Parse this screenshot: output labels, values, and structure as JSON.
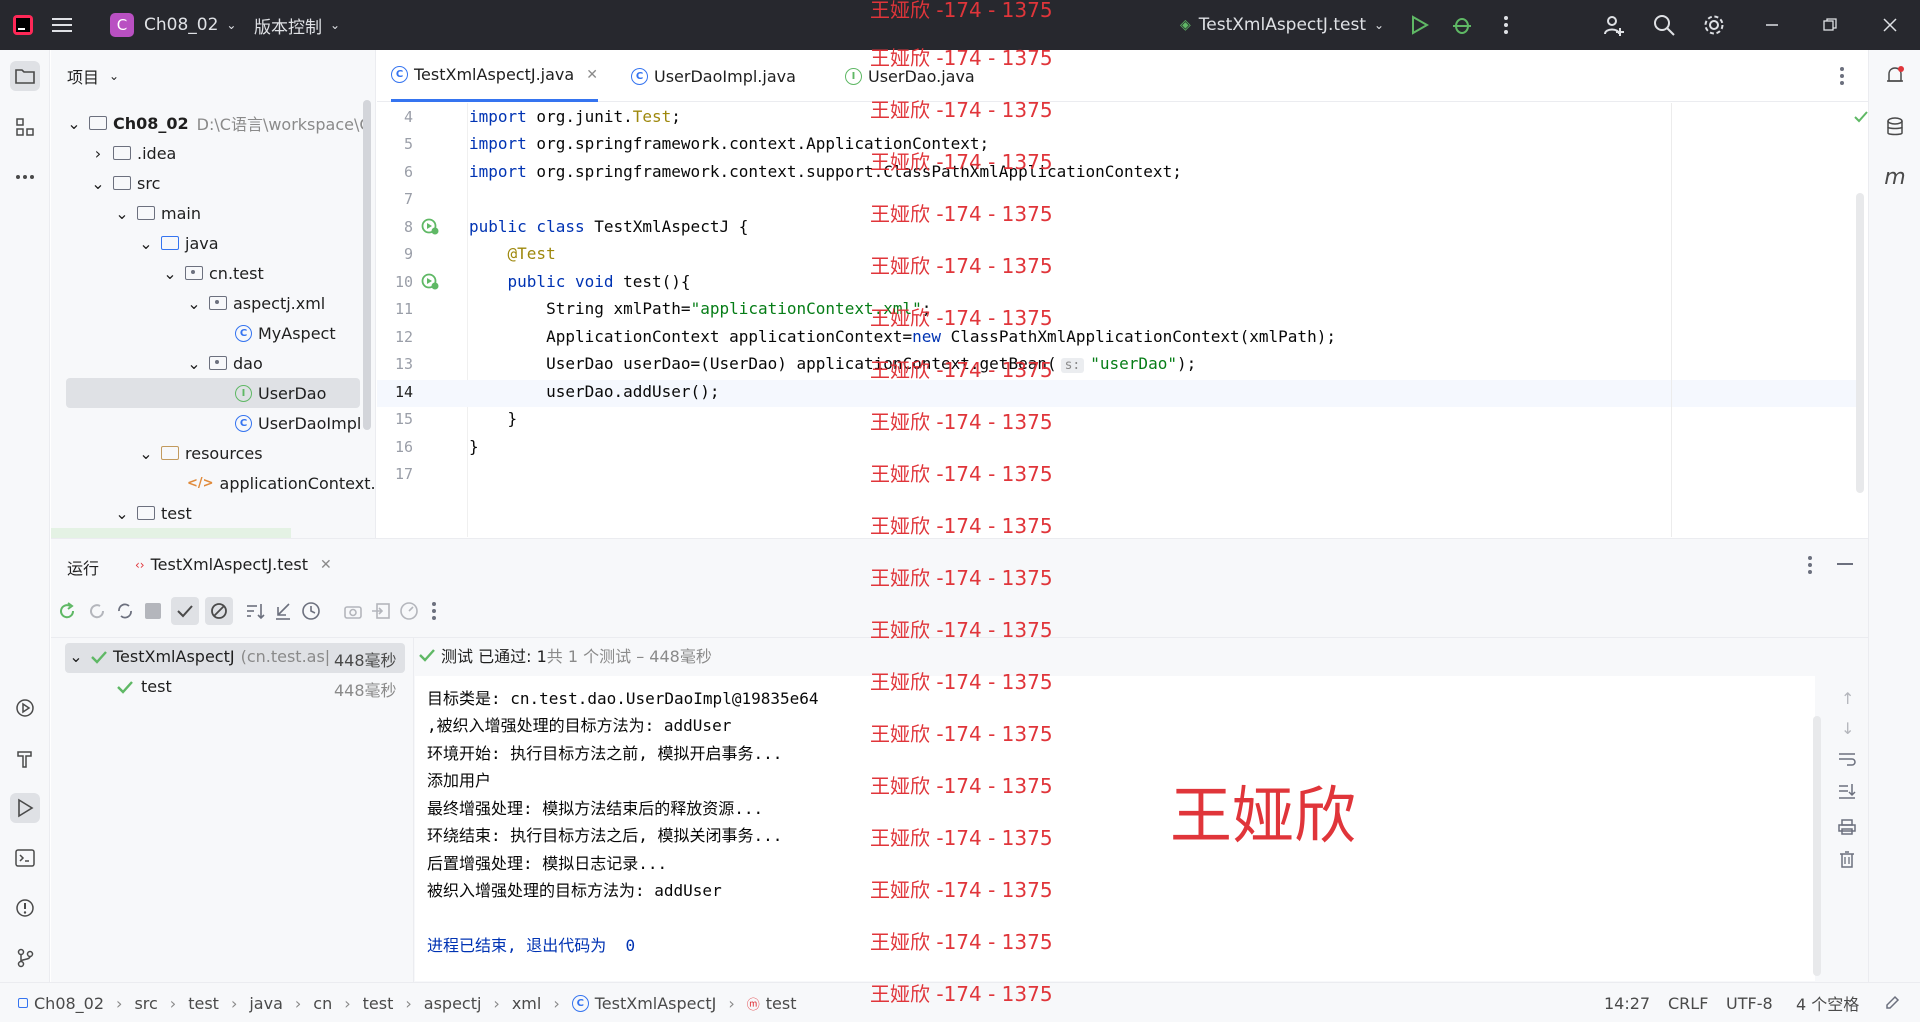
{
  "titlebar": {
    "project_initial": "C",
    "project_name": "Ch08_02",
    "vcs_menu": "版本控制",
    "run_config": "TestXmlAspectJ.test"
  },
  "project_panel": {
    "title": "项目",
    "tree": [
      {
        "label": "Ch08_02",
        "path": "D:\\C语言\\workspace\\C",
        "icon": "folder-icon"
      },
      {
        "label": ".idea",
        "icon": "folder-icon"
      },
      {
        "label": "src",
        "icon": "folder-icon"
      },
      {
        "label": "main",
        "icon": "folder-icon"
      },
      {
        "label": "java",
        "icon": "source-folder-icon"
      },
      {
        "label": "cn.test",
        "icon": "package-icon"
      },
      {
        "label": "aspectj.xml",
        "icon": "package-icon"
      },
      {
        "label": "MyAspect",
        "icon": "class-icon"
      },
      {
        "label": "dao",
        "icon": "package-icon"
      },
      {
        "label": "UserDao",
        "icon": "interface-icon"
      },
      {
        "label": "UserDaoImpl",
        "icon": "class-icon"
      },
      {
        "label": "resources",
        "icon": "resources-folder-icon"
      },
      {
        "label": "applicationContext.xn",
        "icon": "xml-file-icon"
      },
      {
        "label": "test",
        "icon": "folder-icon"
      }
    ]
  },
  "editor_tabs": [
    {
      "label": "TestXmlAspectJ.java",
      "active": true
    },
    {
      "label": "UserDaoImpl.java",
      "active": false
    },
    {
      "label": "UserDao.java",
      "active": false
    }
  ],
  "code": {
    "line_numbers": [
      "4",
      "5",
      "6",
      "7",
      "8",
      "9",
      "10",
      "11",
      "12",
      "13",
      "14",
      "15",
      "16",
      "17"
    ],
    "l4_kw": "import",
    "l4_rest": " org.junit.",
    "l4_cls": "Test",
    "l4_end": ";",
    "l5_kw": "import",
    "l5_rest": " org.springframework.context.ApplicationContext;",
    "l6_kw": "import",
    "l6_rest": " org.springframework.context.support.ClassPathXmlApplicationContext;",
    "l8_kw": "public class",
    "l8_rest": " TestXmlAspectJ {",
    "l9_ann": "@Test",
    "l10_kw": "public void",
    "l10_rest": " test(){",
    "l11_a": "String xmlPath=",
    "l11_str": "\"applicationContext.xml\"",
    "l11_end": ";",
    "l12_a": "ApplicationContext applicationContext=",
    "l12_kw": "new",
    "l12_rest": " ClassPathXmlApplicationContext(xmlPath);",
    "l13_a": "UserDao userDao=(UserDao) applicationContext.getBean(",
    "l13_hint": "s:",
    "l13_str": "\"userDao\"",
    "l13_end": ");",
    "l14": "userDao.addUser();",
    "l15": "}",
    "l16": "}"
  },
  "run_panel": {
    "title": "运行",
    "tab_label": "TestXmlAspectJ.test",
    "status_prefix": "测试 已通过: 1",
    "status_suffix": "共 1 个测试 – 448毫秒",
    "tests": [
      {
        "name": "TestXmlAspectJ",
        "package": "(cn.test.as|",
        "time": "448毫秒"
      },
      {
        "name": "test",
        "time": "448毫秒"
      }
    ],
    "console": [
      "目标类是: cn.test.dao.UserDaoImpl@19835e64",
      ",被织入增强处理的目标方法为: addUser",
      "环境开始: 执行目标方法之前, 模拟开启事务...",
      "添加用户",
      "最终增强处理: 模拟方法结束后的释放资源...",
      "环绕结束: 执行目标方法之后, 模拟关闭事务...",
      "后置增强处理: 模拟日志记录...",
      "被织入增强处理的目标方法为: addUser",
      "",
      "进程已结束, 退出代码为  0"
    ]
  },
  "statusbar": {
    "breadcrumbs": [
      "Ch08_02",
      "src",
      "test",
      "java",
      "cn",
      "test",
      "aspectj",
      "xml",
      "TestXmlAspectJ",
      "test"
    ],
    "position": "14:27",
    "line_ending": "CRLF",
    "encoding": "UTF-8",
    "indent": "4 个空格"
  },
  "watermark": {
    "line": "王娅欣 -174 - 1375",
    "name": "王娅欣"
  },
  "colors": {
    "accent": "#3574f0",
    "run_green": "#5fb865",
    "watermark_red": "#e0353a",
    "titlebar_bg": "#27282e"
  }
}
